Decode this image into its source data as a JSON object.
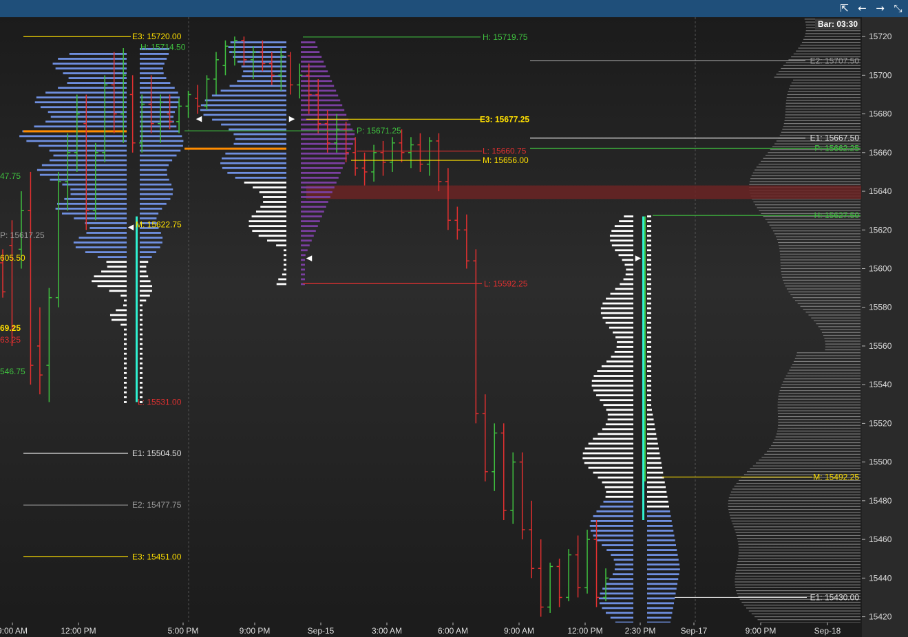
{
  "toolbar": {
    "background": "#1f4f7a",
    "icons": [
      "popout-icon",
      "arrow-left-icon",
      "arrow-right-icon",
      "collapse-icon"
    ]
  },
  "bar_label": "Bar: 03:30",
  "colors": {
    "up": "#3fc03f",
    "down": "#e03030",
    "profile_value": "#6f8fe0",
    "profile_outside": "#ffffff",
    "profile_purple": "#7a3fa0",
    "volume_bg": "#8a8a8a",
    "zone": "#6b2424",
    "yellow": "#ffe000",
    "orange": "#ff8c00",
    "grey_line": "#9a9a9a",
    "white_line": "#e0e0e0",
    "green_line": "#3fc03f",
    "red_line": "#e03030",
    "cyan": "#2ff0d0"
  },
  "chart_data": {
    "type": "ohlc-market-profile",
    "price_axis": {
      "min": 15417,
      "max": 15730,
      "ticks": [
        15720,
        15700,
        15680,
        15660,
        15640,
        15620,
        15600,
        15580,
        15560,
        15540,
        15520,
        15500,
        15480,
        15460,
        15440,
        15420
      ]
    },
    "time_axis": {
      "labels": [
        "9:00 AM",
        "12:00 PM",
        "5:00 PM",
        "9:00 PM",
        "Sep-15",
        "3:00 AM",
        "6:00 AM",
        "9:00 AM",
        "12:00 PM",
        "2:30 PM",
        "Sep-17",
        "9:00 PM",
        "Sep-18"
      ]
    },
    "levels": [
      {
        "text": "E3: 15720.00",
        "price": 15720.0,
        "color": "yellow"
      },
      {
        "text": "H: 15714.50",
        "price": 15714.5,
        "color": "green"
      },
      {
        "text": "H: 15719.75",
        "price": 15719.75,
        "color": "green"
      },
      {
        "text": "E2: 15707.50",
        "price": 15707.5,
        "color": "grey"
      },
      {
        "text": "E3: 15677.25",
        "price": 15677.25,
        "color": "yellow"
      },
      {
        "text": "P: 15671.25",
        "price": 15671.25,
        "color": "green"
      },
      {
        "text": "E1: 15667.50",
        "price": 15667.5,
        "color": "white"
      },
      {
        "text": "P: 15662.25",
        "price": 15662.25,
        "color": "green"
      },
      {
        "text": "L: 15660.75",
        "price": 15660.75,
        "color": "red"
      },
      {
        "text": "M: 15656.00",
        "price": 15656.0,
        "color": "yellow"
      },
      {
        "text": "H: 15627.50",
        "price": 15627.5,
        "color": "green"
      },
      {
        "text": "M: 15622.75",
        "price": 15622.75,
        "color": "yellow"
      },
      {
        "text": "P: 15617.25",
        "price": 15617.25,
        "color": "grey"
      },
      {
        "text": "605.50",
        "price": 15605.5,
        "color": "yellow"
      },
      {
        "text": "L: 15592.25",
        "price": 15592.25,
        "color": "red"
      },
      {
        "text": "69.25",
        "price": 15569.25,
        "color": "yellow"
      },
      {
        "text": "63.25",
        "price": 15563.25,
        "color": "red"
      },
      {
        "text": "546.75",
        "price": 15546.75,
        "color": "green"
      },
      {
        "text": "L: 15531.00",
        "price": 15531.0,
        "color": "red"
      },
      {
        "text": "E1: 15504.50",
        "price": 15504.5,
        "color": "white"
      },
      {
        "text": "M: 15492.25",
        "price": 15492.25,
        "color": "yellow"
      },
      {
        "text": "E2: 15477.75",
        "price": 15477.75,
        "color": "grey"
      },
      {
        "text": "E3: 15451.00",
        "price": 15451.0,
        "color": "yellow"
      },
      {
        "text": "E1: 15430.00",
        "price": 15430.0,
        "color": "white"
      },
      {
        "text": "47.75",
        "price": 15647.75,
        "color": "green"
      }
    ],
    "zones": [
      {
        "from": 15636,
        "to": 15643,
        "color": "zone"
      }
    ],
    "bars": [
      {
        "o": 15603,
        "h": 15610,
        "l": 15585,
        "c": 15588
      },
      {
        "o": 15612,
        "h": 15625,
        "l": 15560,
        "c": 15570
      },
      {
        "o": 15610,
        "h": 15640,
        "l": 15600,
        "c": 15630
      },
      {
        "o": 15630,
        "h": 15650,
        "l": 15540,
        "c": 15550
      },
      {
        "o": 15560,
        "h": 15580,
        "l": 15535,
        "c": 15545
      },
      {
        "o": 15550,
        "h": 15590,
        "l": 15531,
        "c": 15585
      },
      {
        "o": 15585,
        "h": 15650,
        "l": 15580,
        "c": 15645
      },
      {
        "o": 15645,
        "h": 15670,
        "l": 15630,
        "c": 15660
      },
      {
        "o": 15660,
        "h": 15690,
        "l": 15650,
        "c": 15680
      },
      {
        "o": 15675,
        "h": 15690,
        "l": 15620,
        "c": 15630
      },
      {
        "o": 15630,
        "h": 15665,
        "l": 15625,
        "c": 15660
      },
      {
        "o": 15660,
        "h": 15700,
        "l": 15655,
        "c": 15695
      },
      {
        "o": 15695,
        "h": 15712,
        "l": 15670,
        "c": 15680
      },
      {
        "o": 15680,
        "h": 15714,
        "l": 15665,
        "c": 15700
      },
      {
        "o": 15690,
        "h": 15700,
        "l": 15660,
        "c": 15665
      },
      {
        "o": 15665,
        "h": 15690,
        "l": 15660,
        "c": 15685
      },
      {
        "o": 15685,
        "h": 15700,
        "l": 15670,
        "c": 15675
      },
      {
        "o": 15675,
        "h": 15690,
        "l": 15665,
        "c": 15686
      },
      {
        "o": 15680,
        "h": 15690,
        "l": 15672,
        "c": 15676
      },
      {
        "o": 15676,
        "h": 15688,
        "l": 15670,
        "c": 15684
      },
      {
        "o": 15684,
        "h": 15692,
        "l": 15678,
        "c": 15690
      },
      {
        "o": 15688,
        "h": 15695,
        "l": 15680,
        "c": 15684
      },
      {
        "o": 15684,
        "h": 15700,
        "l": 15682,
        "c": 15698
      },
      {
        "o": 15698,
        "h": 15712,
        "l": 15690,
        "c": 15708
      },
      {
        "o": 15705,
        "h": 15718,
        "l": 15700,
        "c": 15715
      },
      {
        "o": 15712,
        "h": 15720,
        "l": 15705,
        "c": 15718
      },
      {
        "o": 15718,
        "h": 15720,
        "l": 15705,
        "c": 15708
      },
      {
        "o": 15708,
        "h": 15715,
        "l": 15698,
        "c": 15712
      },
      {
        "o": 15712,
        "h": 15718,
        "l": 15702,
        "c": 15706
      },
      {
        "o": 15706,
        "h": 15712,
        "l": 15695,
        "c": 15700
      },
      {
        "o": 15700,
        "h": 15714,
        "l": 15692,
        "c": 15710
      },
      {
        "o": 15710,
        "h": 15712,
        "l": 15690,
        "c": 15695
      },
      {
        "o": 15695,
        "h": 15706,
        "l": 15688,
        "c": 15700
      },
      {
        "o": 15700,
        "h": 15706,
        "l": 15680,
        "c": 15690
      },
      {
        "o": 15690,
        "h": 15698,
        "l": 15670,
        "c": 15675
      },
      {
        "o": 15675,
        "h": 15682,
        "l": 15660,
        "c": 15665
      },
      {
        "o": 15665,
        "h": 15680,
        "l": 15660,
        "c": 15672
      },
      {
        "o": 15672,
        "h": 15676,
        "l": 15655,
        "c": 15660
      },
      {
        "o": 15660,
        "h": 15668,
        "l": 15648,
        "c": 15652
      },
      {
        "o": 15652,
        "h": 15660,
        "l": 15643,
        "c": 15650
      },
      {
        "o": 15650,
        "h": 15664,
        "l": 15645,
        "c": 15660
      },
      {
        "o": 15660,
        "h": 15666,
        "l": 15648,
        "c": 15655
      },
      {
        "o": 15655,
        "h": 15668,
        "l": 15650,
        "c": 15665
      },
      {
        "o": 15665,
        "h": 15672,
        "l": 15655,
        "c": 15660
      },
      {
        "o": 15660,
        "h": 15668,
        "l": 15652,
        "c": 15664
      },
      {
        "o": 15664,
        "h": 15670,
        "l": 15650,
        "c": 15654
      },
      {
        "o": 15654,
        "h": 15668,
        "l": 15648,
        "c": 15666
      },
      {
        "o": 15666,
        "h": 15670,
        "l": 15640,
        "c": 15645
      },
      {
        "o": 15645,
        "h": 15652,
        "l": 15620,
        "c": 15625
      },
      {
        "o": 15625,
        "h": 15632,
        "l": 15615,
        "c": 15620
      },
      {
        "o": 15620,
        "h": 15628,
        "l": 15600,
        "c": 15604
      },
      {
        "o": 15604,
        "h": 15610,
        "l": 15520,
        "c": 15525
      },
      {
        "o": 15525,
        "h": 15535,
        "l": 15490,
        "c": 15495
      },
      {
        "o": 15495,
        "h": 15520,
        "l": 15485,
        "c": 15515
      },
      {
        "o": 15515,
        "h": 15520,
        "l": 15470,
        "c": 15475
      },
      {
        "o": 15475,
        "h": 15505,
        "l": 15468,
        "c": 15500
      },
      {
        "o": 15500,
        "h": 15505,
        "l": 15460,
        "c": 15465
      },
      {
        "o": 15465,
        "h": 15480,
        "l": 15440,
        "c": 15445
      },
      {
        "o": 15445,
        "h": 15460,
        "l": 15420,
        "c": 15425
      },
      {
        "o": 15425,
        "h": 15448,
        "l": 15422,
        "c": 15446
      },
      {
        "o": 15446,
        "h": 15450,
        "l": 15425,
        "c": 15430
      },
      {
        "o": 15430,
        "h": 15455,
        "l": 15428,
        "c": 15452
      },
      {
        "o": 15452,
        "h": 15462,
        "l": 15430,
        "c": 15435
      },
      {
        "o": 15435,
        "h": 15465,
        "l": 15432,
        "c": 15460
      },
      {
        "o": 15460,
        "h": 15470,
        "l": 15425,
        "c": 15430
      },
      {
        "o": 15430,
        "h": 15445,
        "l": 15428,
        "c": 15440
      }
    ]
  }
}
